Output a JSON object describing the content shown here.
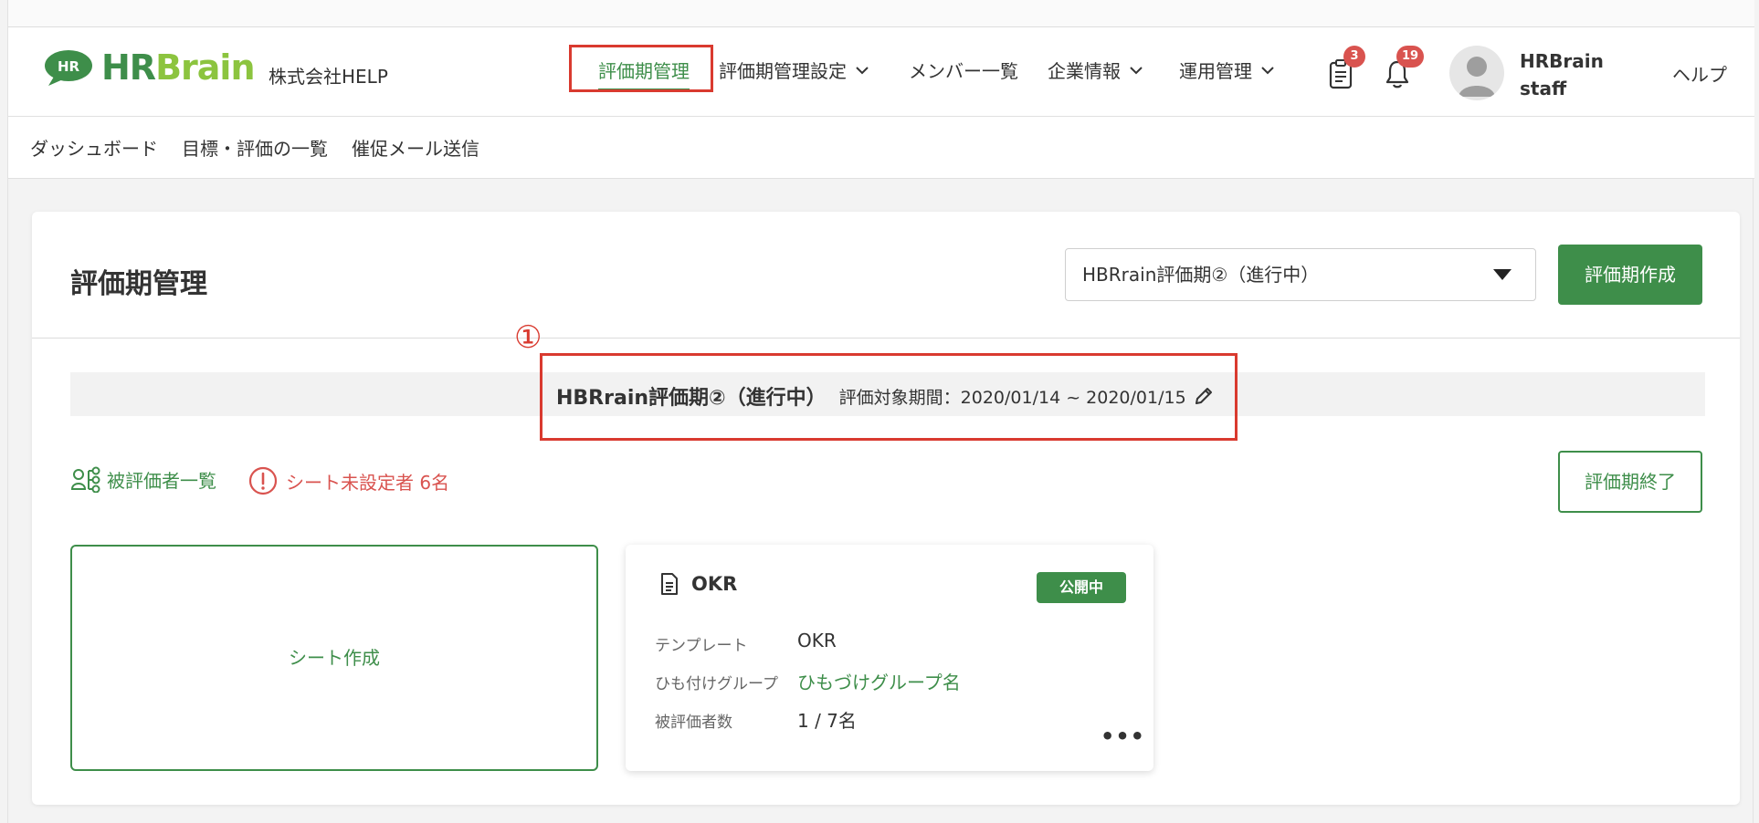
{
  "header": {
    "logo_hr": "HR",
    "logo_brand_hr": "HR",
    "logo_brand_brain": "Brain",
    "company": "株式会社HELP",
    "nav": [
      {
        "label": "評価期管理",
        "active": true
      },
      {
        "label": "評価期管理設定",
        "dropdown": true
      },
      {
        "label": "メンバー一覧"
      },
      {
        "label": "企業情報",
        "dropdown": true
      },
      {
        "label": "運用管理",
        "dropdown": true
      }
    ],
    "task_count": "3",
    "notification_count": "19",
    "user_name_line1": "HRBrain",
    "user_name_line2": "staff",
    "help": "ヘルプ"
  },
  "subnav": {
    "items": [
      "ダッシュボード",
      "目標・評価の一覧",
      "催促メール送信"
    ]
  },
  "page": {
    "title": "評価期管理",
    "period_select_value": "HBRrain評価期②（進行中）",
    "create_button": "評価期作成",
    "annotation_marker": "①",
    "period_name": "HBRrain評価期②（進行中）",
    "period_range": "評価対象期間：2020/01/14 ~ 2020/01/15",
    "evaluatee_list": "被評価者一覧",
    "unset_warning": "シート未設定者 6名",
    "end_button": "評価期終了",
    "sheet_create": "シート作成"
  },
  "sheet_card": {
    "title": "OKR",
    "status": "公開中",
    "rows": [
      {
        "label": "テンプレート",
        "value": "OKR"
      },
      {
        "label": "ひも付けグループ",
        "value": "ひもづけグループ名"
      },
      {
        "label": "被評価者数",
        "value": "1 / 7名"
      }
    ],
    "more": "•••"
  },
  "colors": {
    "brand_green": "#3e8e4a",
    "brand_light_green": "#8cc43f",
    "alert_red": "#d9534f",
    "annotation_red": "#d93a2f"
  }
}
